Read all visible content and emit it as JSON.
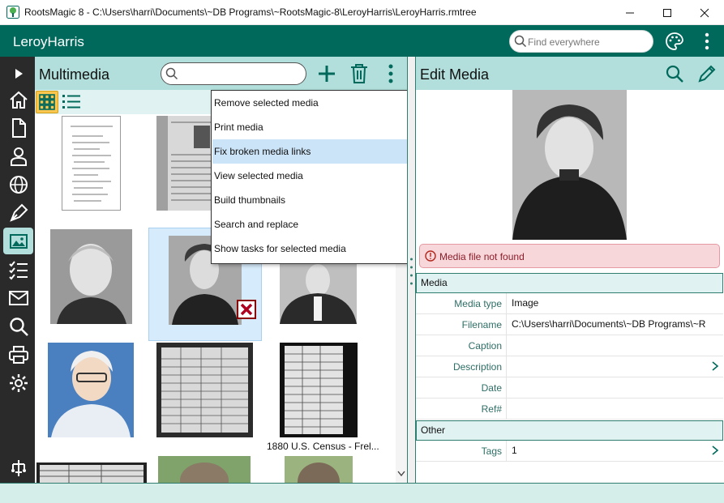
{
  "window": {
    "title": "RootsMagic 8 - C:\\Users\\harri\\Documents\\~DB Programs\\~RootsMagic-8\\LeroyHarris\\LeroyHarris.rmtree"
  },
  "app": {
    "name": "LeroyHarris",
    "search_placeholder": "Find everywhere"
  },
  "colors": {
    "header": "#00695c",
    "panel_header": "#b2dfdb",
    "sidebar": "#2a2a2a",
    "accent": "#00695c",
    "error_bg": "#f8d7da"
  },
  "sidebar": {
    "items": [
      "expand-icon",
      "home-icon",
      "document-icon",
      "person-icon",
      "globe-icon",
      "pen-icon",
      "media-icon",
      "tasks-icon",
      "mail-icon",
      "search-icon",
      "print-icon",
      "settings-icon",
      "tree-icon"
    ],
    "active": "media-icon"
  },
  "multimedia": {
    "title": "Multimedia",
    "view_modes": [
      "grid-view",
      "list-view"
    ],
    "items": [
      {
        "caption": ""
      },
      {
        "caption": ""
      },
      {
        "caption": ""
      },
      {
        "caption": ""
      },
      {
        "caption": ""
      },
      {
        "caption": ""
      },
      {
        "caption": ""
      },
      {
        "caption": ""
      },
      {
        "caption": "1880 U.S. Census - Frel..."
      },
      {
        "caption": ""
      },
      {
        "caption": ""
      },
      {
        "caption": ""
      }
    ]
  },
  "context_menu": {
    "items": [
      "Remove selected media",
      "Print media",
      "Fix broken media links",
      "View selected media",
      "Build thumbnails",
      "Search and replace",
      "Show tasks for selected media"
    ],
    "highlighted": "Fix broken media links"
  },
  "edit_media": {
    "title": "Edit Media",
    "error": "Media file not found",
    "media_section": "Media",
    "fields": [
      {
        "label": "Media type",
        "value": "Image"
      },
      {
        "label": "Filename",
        "value": "C:\\Users\\harri\\Documents\\~DB Programs\\~R"
      },
      {
        "label": "Caption",
        "value": ""
      },
      {
        "label": "Description",
        "value": ""
      },
      {
        "label": "Date",
        "value": ""
      },
      {
        "label": "Ref#",
        "value": ""
      }
    ],
    "other_section": "Other",
    "tags": {
      "label": "Tags",
      "value": "1"
    }
  }
}
